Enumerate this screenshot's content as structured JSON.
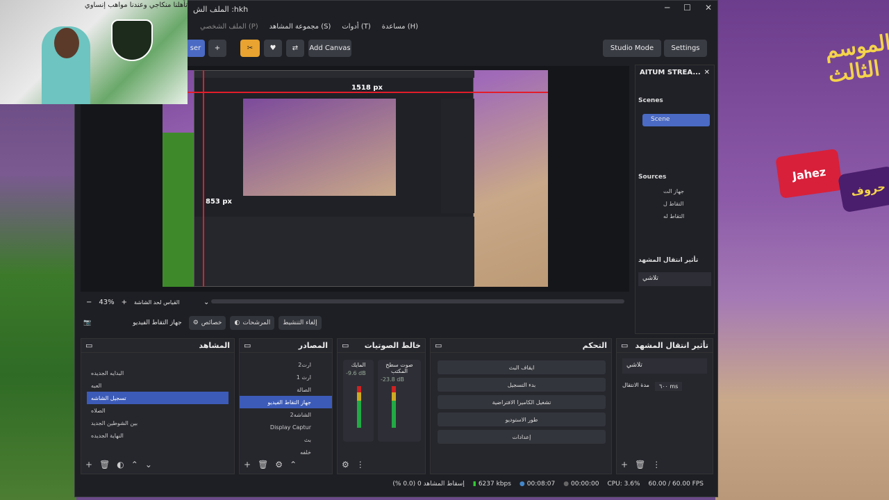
{
  "webcam": {
    "caption": "تأهلنا منكاجي وعندنا مواهب إنساوي"
  },
  "background": {
    "banner": "الموسم الثالث",
    "jahez": "Jahez",
    "badge": "حروف"
  },
  "window": {
    "title": "الملف الش :hkh",
    "minimize": "─",
    "maximize": "☐",
    "close": "✕"
  },
  "menu": [
    "الملف الشخصي (P)",
    "مجموعة المشاهد (S)",
    "أدوات (T)",
    "مساعدة (H)"
  ],
  "toolbar": {
    "user_label": "ser",
    "plus": "+",
    "add_canvas": "Add Canvas",
    "studio_mode": "Studio Mode",
    "settings": "Settings"
  },
  "preview": {
    "width_label": "1518 px",
    "height_label": "853 px"
  },
  "previewbar": {
    "minus": "−",
    "zoom": "43%",
    "plus": "+",
    "scale_mode": "القياس لحد الشاشة"
  },
  "context": {
    "source_name": "جهاز التقاط الفيديو",
    "properties": "خصائص",
    "filters": "المرشحات",
    "deactivate": "إلغاء التنشيط"
  },
  "right_dock": {
    "title": "AITUM STREA...",
    "scenes_title": "Scenes",
    "scene": "Scene",
    "sources_title": "Sources",
    "sources": [
      "جهاز الت",
      "التقاط ل",
      "التقاط له"
    ],
    "transition_title": "تأثير انتقال المشهد",
    "transition_value": "تلاشي"
  },
  "scenes_dock": {
    "title": "المشاهد",
    "items": [
      "البدايه الجديده",
      "العبه",
      "تسجيل الشاشه",
      "الصلاه",
      "بين الشوطين الجديد",
      "النهاية الجديده"
    ],
    "selected_index": 2
  },
  "sources_dock": {
    "title": "المصادر",
    "items": [
      "ارت2",
      "ارث 1",
      "الصالة",
      "جهاز التقاط الفيديو",
      "الشاشه2",
      "Display Captur",
      "بث",
      "خلفه"
    ]
  },
  "mixer_dock": {
    "title": "خالط الصوتيات",
    "channels": [
      {
        "name": "المايك",
        "db": "-9.6 dB"
      },
      {
        "name": "صوت سطح المكتب",
        "db": "-23.8 dB"
      }
    ]
  },
  "controls_dock": {
    "title": "التحكم",
    "buttons": [
      "ايقاف البث",
      "بدء التسجيل",
      "تشغيل الكاميرا الافتراضية",
      "طور الاستوديو",
      "إعدادات"
    ]
  },
  "transition_dock": {
    "title": "تأثير انتقال المشهد",
    "value": "تلاشي",
    "duration_label": "مدة الانتقال",
    "duration_value": "٦٠٠ ms"
  },
  "status": {
    "dropped": "إسقاط المشاهد 0 (0.0 %)",
    "bitrate": "6237 kbps",
    "stream_time": "00:08:07",
    "rec_time": "00:00:00",
    "cpu": "CPU: 3.6%",
    "fps": "60.00 / 60.00 FPS"
  },
  "colors": {
    "accent": "#3c5bb8",
    "orange": "#e8a330",
    "red": "#e21c2a"
  }
}
